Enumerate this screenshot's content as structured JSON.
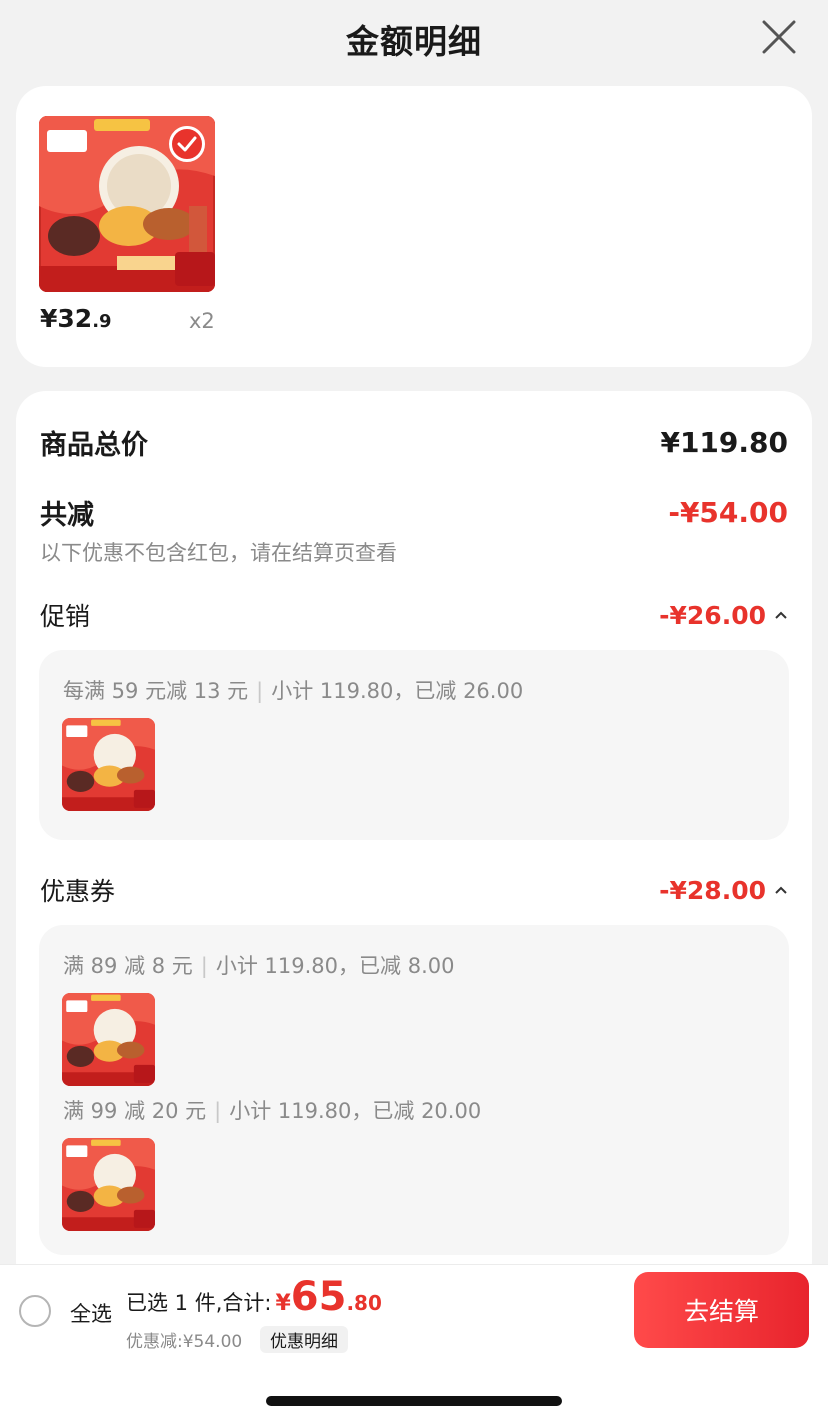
{
  "header": {
    "title": "金额明细"
  },
  "product": {
    "price_symbol": "¥",
    "price_int": "32",
    "price_dec": ".9",
    "quantity": "x2",
    "image_label": "gift-box-product"
  },
  "summary": {
    "total_label": "商品总价",
    "total_value": "¥119.80",
    "reduce_label": "共减",
    "reduce_value": "-¥54.00",
    "hint": "以下优惠不包含红包，请在结算页查看"
  },
  "promotion": {
    "label": "促销",
    "value": "-¥26.00",
    "rules": [
      {
        "rule": "每满 59 元减 13 元",
        "subtotal": "小计 119.80，已减 26.00"
      }
    ]
  },
  "coupon": {
    "label": "优惠券",
    "value": "-¥28.00",
    "rules": [
      {
        "rule": "满 89 减 8 元",
        "subtotal": "小计 119.80，已减 8.00"
      },
      {
        "rule": "满 99 减 20 元",
        "subtotal": "小计 119.80，已减 20.00"
      }
    ]
  },
  "bottom_bar": {
    "select_all": "全选",
    "selected_total_label": "已选 1 件,合计:",
    "total_symbol": "¥",
    "total_int": "65",
    "total_dec": ".80",
    "discount_text": "优惠减:¥54.00",
    "detail_link": "优惠明细",
    "checkout": "去结算"
  },
  "colors": {
    "accent": "#e8332c",
    "background": "#f2f2f2",
    "card": "#ffffff"
  }
}
